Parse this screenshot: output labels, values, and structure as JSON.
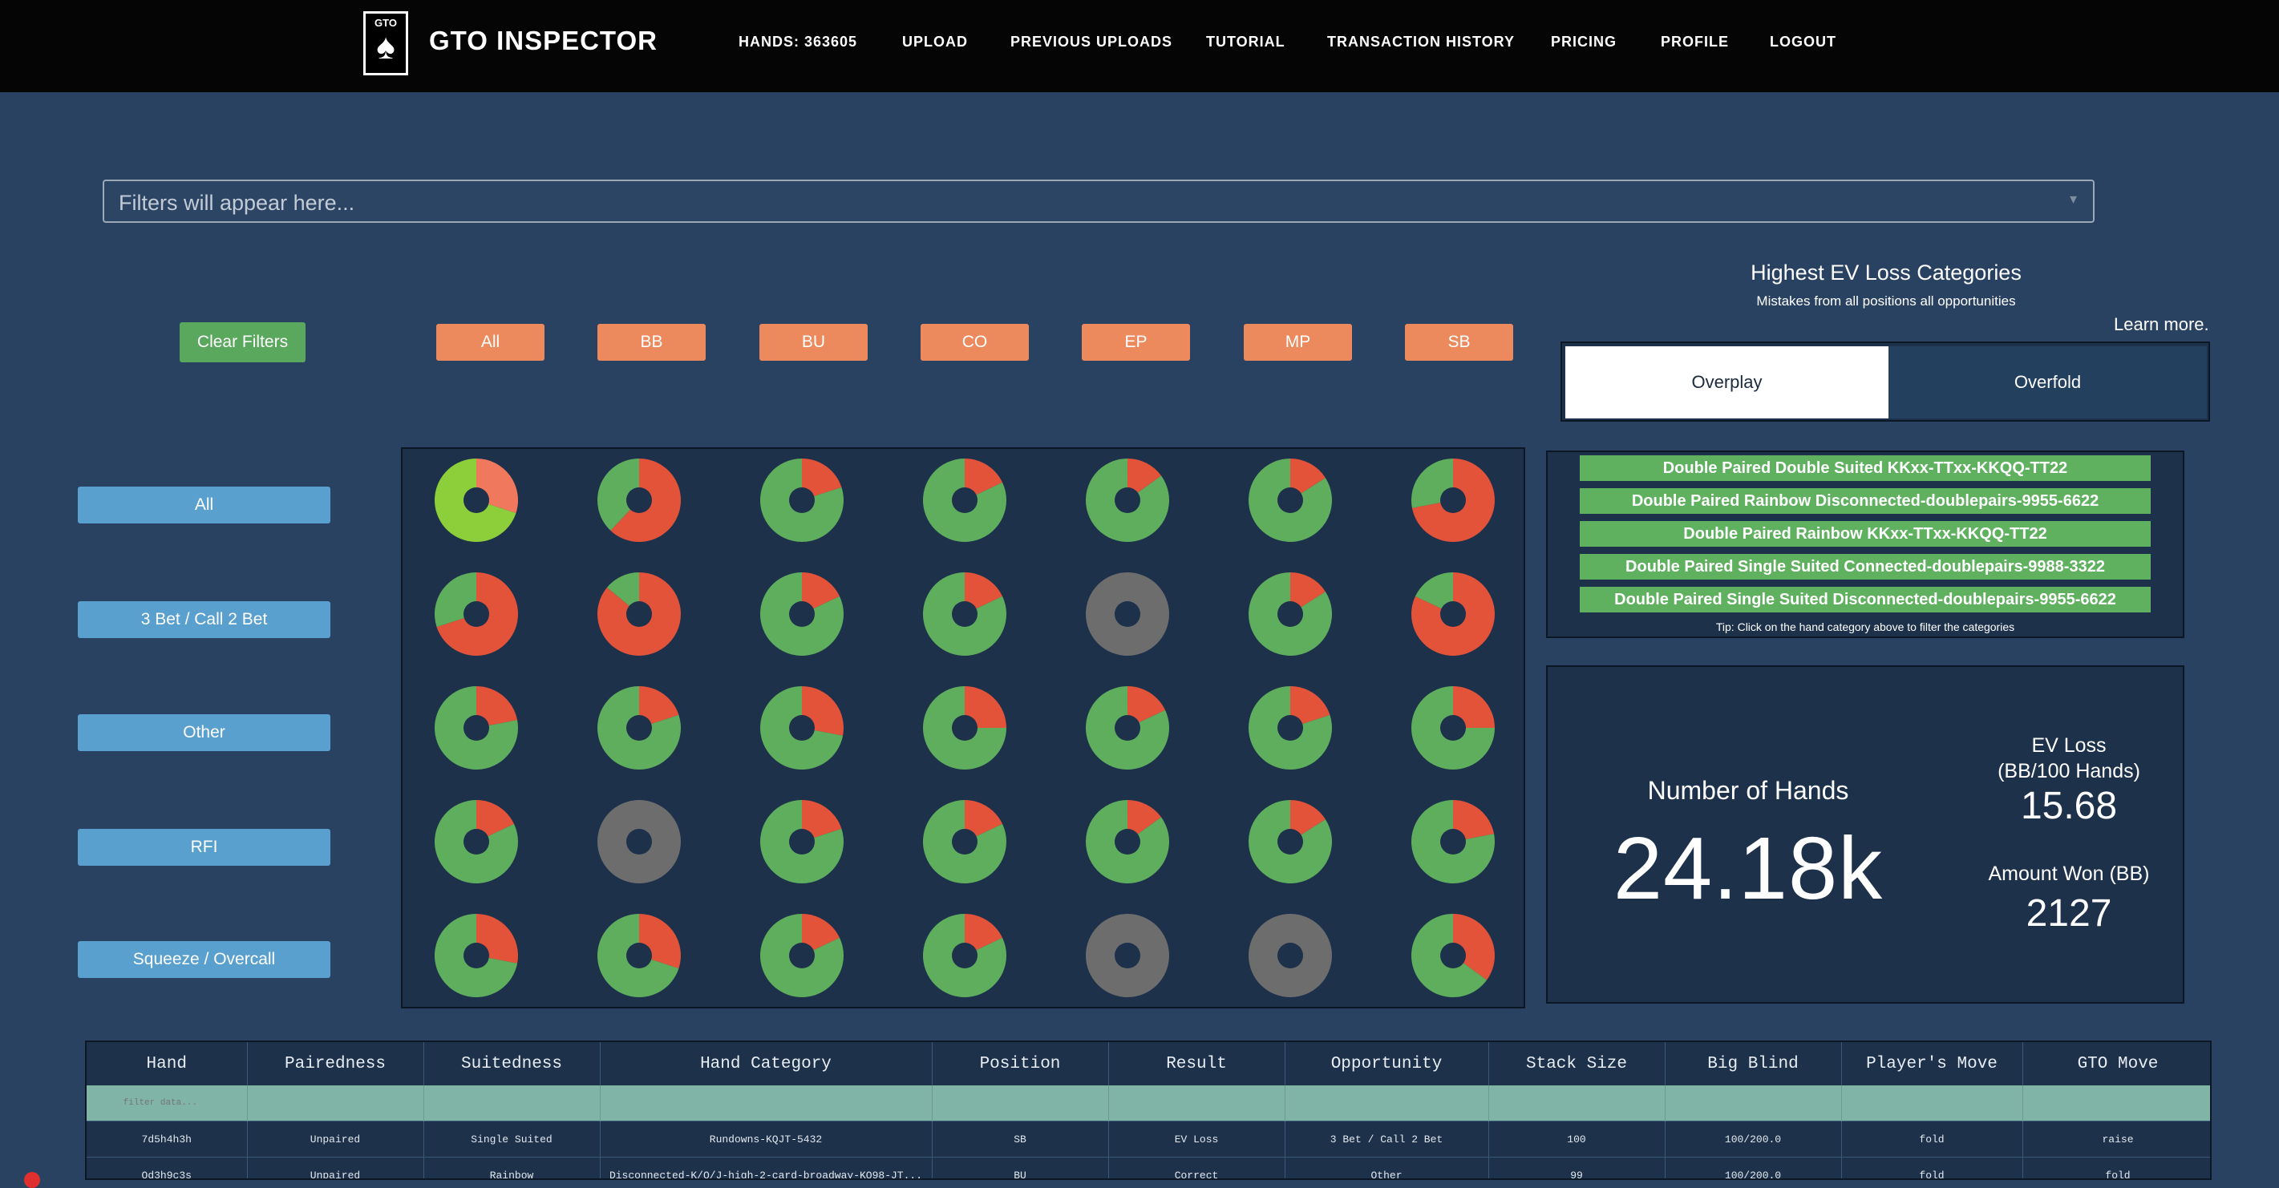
{
  "nav": {
    "logo_small": "GTO",
    "brand": "GTO INSPECTOR",
    "items": [
      "HANDS: 363605",
      "UPLOAD",
      "PREVIOUS UPLOADS",
      "TUTORIAL",
      "TRANSACTION HISTORY",
      "PRICING",
      "PROFILE",
      "LOGOUT"
    ]
  },
  "filter": {
    "placeholder": "Filters will appear here..."
  },
  "clear_filters_label": "Clear Filters",
  "positions": [
    "All",
    "BB",
    "BU",
    "CO",
    "EP",
    "MP",
    "SB"
  ],
  "opportunities": [
    "All",
    "3 Bet / Call 2 Bet",
    "Other",
    "RFI",
    "Squeeze / Overcall"
  ],
  "donut_colors": {
    "correct": "#5fae5d",
    "ev_loss": "#e2533a",
    "bright": "#8ccf3a",
    "salmon": "#f0785c",
    "empty": "#6d6d6d"
  },
  "donut_grid": [
    [
      {
        "loss": 0.3,
        "style": "bright"
      },
      {
        "loss": 0.62,
        "style": "normal"
      },
      {
        "loss": 0.2,
        "style": "normal"
      },
      {
        "loss": 0.18,
        "style": "normal"
      },
      {
        "loss": 0.15,
        "style": "normal"
      },
      {
        "loss": 0.16,
        "style": "normal"
      },
      {
        "loss": 0.72,
        "style": "normal"
      }
    ],
    [
      {
        "loss": 0.7,
        "style": "normal"
      },
      {
        "loss": 0.86,
        "style": "normal"
      },
      {
        "loss": 0.18,
        "style": "normal"
      },
      {
        "loss": 0.18,
        "style": "normal"
      },
      {
        "loss": null,
        "style": "empty"
      },
      {
        "loss": 0.16,
        "style": "normal"
      },
      {
        "loss": 0.82,
        "style": "normal"
      }
    ],
    [
      {
        "loss": 0.22,
        "style": "normal"
      },
      {
        "loss": 0.2,
        "style": "normal"
      },
      {
        "loss": 0.28,
        "style": "normal"
      },
      {
        "loss": 0.25,
        "style": "normal"
      },
      {
        "loss": 0.18,
        "style": "normal"
      },
      {
        "loss": 0.2,
        "style": "normal"
      },
      {
        "loss": 0.25,
        "style": "normal"
      }
    ],
    [
      {
        "loss": 0.18,
        "style": "normal"
      },
      {
        "loss": null,
        "style": "empty"
      },
      {
        "loss": 0.2,
        "style": "normal"
      },
      {
        "loss": 0.18,
        "style": "normal"
      },
      {
        "loss": 0.15,
        "style": "normal"
      },
      {
        "loss": 0.16,
        "style": "normal"
      },
      {
        "loss": 0.22,
        "style": "normal"
      }
    ],
    [
      {
        "loss": 0.28,
        "style": "normal"
      },
      {
        "loss": 0.3,
        "style": "normal"
      },
      {
        "loss": 0.18,
        "style": "normal"
      },
      {
        "loss": 0.18,
        "style": "normal"
      },
      {
        "loss": null,
        "style": "empty"
      },
      {
        "loss": null,
        "style": "empty"
      },
      {
        "loss": 0.35,
        "style": "normal"
      }
    ]
  ],
  "categories": {
    "title": "Highest EV Loss Categories",
    "subtitle": "Mistakes from all positions all opportunities",
    "learn_more": "Learn more.",
    "tabs": [
      "Overplay",
      "Overfold"
    ],
    "items": [
      "Double Paired Double Suited KKxx-TTxx-KKQQ-TT22",
      "Double Paired Rainbow Disconnected-doublepairs-9955-6622",
      "Double Paired Rainbow KKxx-TTxx-KKQQ-TT22",
      "Double Paired Single Suited Connected-doublepairs-9988-3322",
      "Double Paired Single Suited Disconnected-doublepairs-9955-6622"
    ],
    "tip": "Tip: Click on the hand category above to filter the categories"
  },
  "stats": {
    "num_hands_label": "Number of Hands",
    "num_hands_value": "24.18k",
    "ev_loss_label": "EV Loss",
    "ev_loss_unit": "(BB/100 Hands)",
    "ev_loss_value": "15.68",
    "amount_won_label": "Amount Won (BB)",
    "amount_won_value": "2127"
  },
  "table": {
    "columns": [
      "Hand",
      "Pairedness",
      "Suitedness",
      "Hand Category",
      "Position",
      "Result",
      "Opportunity",
      "Stack Size",
      "Big Blind",
      "Player's Move",
      "GTO Move"
    ],
    "filter_placeholder": "filter data...",
    "rows": [
      [
        "7d5h4h3h",
        "Unpaired",
        "Single Suited",
        "Rundowns-KQJT-5432",
        "SB",
        "EV Loss",
        "3 Bet / Call 2 Bet",
        "100",
        "100/200.0",
        "fold",
        "raise"
      ],
      [
        "Qd3h9c3s",
        "Unpaired",
        "Rainbow",
        "Disconnected-K/Q/J-high-2-card-broadway-KQ98-JT...",
        "BU",
        "Correct",
        "Other",
        "99",
        "100/200.0",
        "fold",
        "fold"
      ]
    ]
  }
}
